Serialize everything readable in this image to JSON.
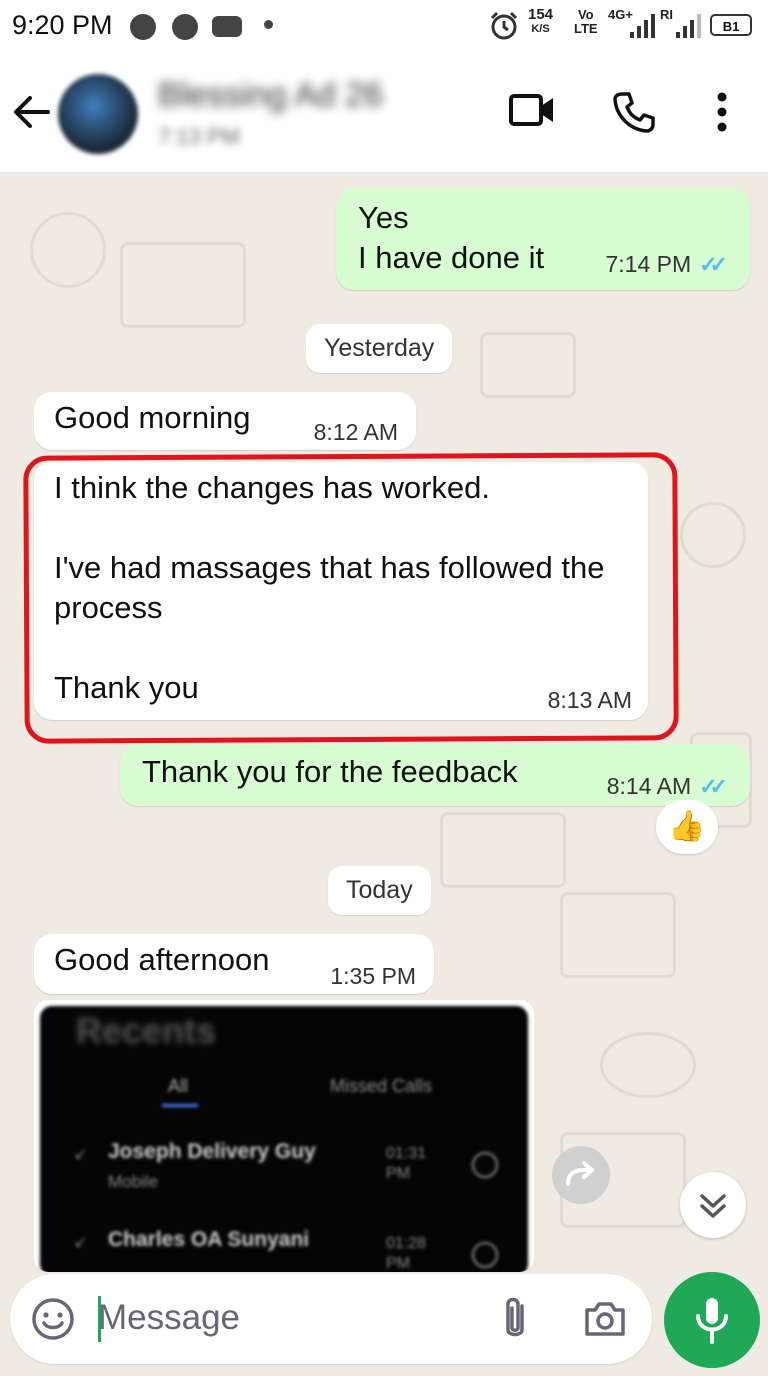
{
  "status_bar": {
    "time": "9:20 PM",
    "speed_value": "154",
    "speed_unit": "K/S",
    "volte_top": "Vo",
    "volte_bottom": "LTE",
    "network": "4G+",
    "sim2": "RI",
    "battery": "B1"
  },
  "header": {
    "contact_name": "Blessing Ad 26",
    "contact_status": "7:13 PM",
    "icons": [
      "back-arrow-icon",
      "video-call-icon",
      "voice-call-icon",
      "more-options-icon"
    ]
  },
  "messages": [
    {
      "dir": "out",
      "text": "Yes\nI have done it",
      "time": "7:14 PM",
      "read": true
    },
    {
      "dir": "divider",
      "text": "Yesterday"
    },
    {
      "dir": "in",
      "text": "Good morning",
      "time": "8:12 AM"
    },
    {
      "dir": "in",
      "text": "I think the changes has worked.\n\nI've had massages that has followed the process\n\nThank you",
      "time": "8:13 AM",
      "highlighted": true
    },
    {
      "dir": "out",
      "text": "Thank you for the feedback",
      "time": "8:14 AM",
      "read": true,
      "reaction": "👍"
    },
    {
      "dir": "divider",
      "text": "Today"
    },
    {
      "dir": "in",
      "text": "Good afternoon",
      "time": "1:35 PM"
    }
  ],
  "shared_image": {
    "title": "Recents",
    "tabs": [
      "All",
      "Missed Calls"
    ],
    "calls": [
      {
        "name": "Joseph Delivery Guy",
        "detail": "Mobile",
        "time": "01:31 PM"
      },
      {
        "name": "Charles OA Sunyani",
        "detail": "",
        "time": "01:28 PM"
      }
    ]
  },
  "composer": {
    "placeholder": "Message",
    "icons": [
      "emoji-icon",
      "attach-icon",
      "camera-icon",
      "mic-icon"
    ]
  },
  "colors": {
    "outgoing_bubble": "#d9fdd3",
    "incoming_bubble": "#ffffff",
    "wallpaper": "#efeae2",
    "read_ticks": "#53bdeb",
    "accent_green": "#1fa855",
    "annotation_red": "#e0141b"
  }
}
